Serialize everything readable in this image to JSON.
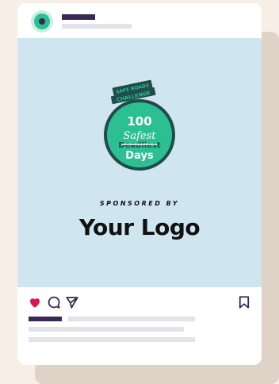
{
  "post": {
    "badge": {
      "top_text": "SAFE ROADS CHALLENGE",
      "number": "100",
      "script_word": "Safest",
      "struck_word": "Deadliest",
      "days": "Days"
    },
    "sponsored_label": "SPONSORED BY",
    "logo_text": "Your Logo"
  },
  "icons": {
    "heart": "heart-icon",
    "comment": "comment-icon",
    "share": "share-icon",
    "bookmark": "bookmark-icon"
  },
  "colors": {
    "background": "#f7efe6",
    "post_background": "#cfe5ef",
    "brand_green": "#2cbf91",
    "dark_teal": "#1f4b4a",
    "brand_purple": "#3a2856",
    "heart_red": "#e0154b"
  }
}
